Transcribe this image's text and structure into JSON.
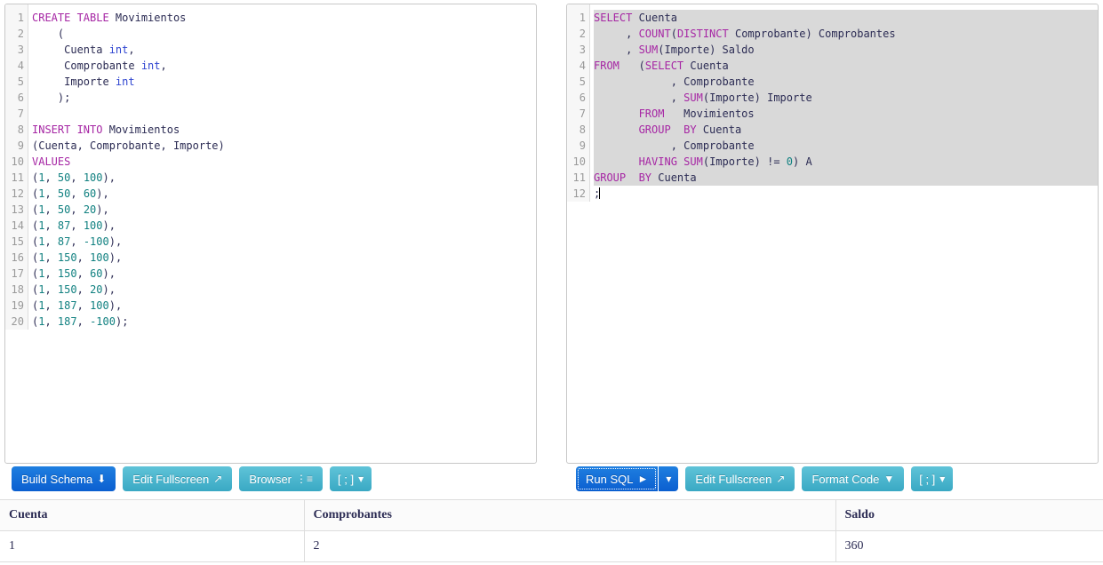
{
  "schema_editor": {
    "name": "schema-sql-editor",
    "line_count": 20,
    "lines": [
      [
        {
          "t": "CREATE TABLE ",
          "c": "kw"
        },
        {
          "t": "Movimientos",
          "c": "id"
        }
      ],
      [
        {
          "t": "    (",
          "c": "id"
        }
      ],
      [
        {
          "t": "     Cuenta ",
          "c": "id"
        },
        {
          "t": "int",
          "c": "typ"
        },
        {
          "t": ",",
          "c": "id"
        }
      ],
      [
        {
          "t": "     Comprobante ",
          "c": "id"
        },
        {
          "t": "int",
          "c": "typ"
        },
        {
          "t": ",",
          "c": "id"
        }
      ],
      [
        {
          "t": "     Importe ",
          "c": "id"
        },
        {
          "t": "int",
          "c": "typ"
        }
      ],
      [
        {
          "t": "    );",
          "c": "id"
        }
      ],
      [],
      [
        {
          "t": "INSERT INTO ",
          "c": "kw"
        },
        {
          "t": "Movimientos",
          "c": "id"
        }
      ],
      [
        {
          "t": "(Cuenta, Comprobante, Importe)",
          "c": "id"
        }
      ],
      [
        {
          "t": "VALUES",
          "c": "kw"
        }
      ],
      [
        {
          "t": "(",
          "c": "id"
        },
        {
          "t": "1",
          "c": "num"
        },
        {
          "t": ", ",
          "c": "id"
        },
        {
          "t": "50",
          "c": "num"
        },
        {
          "t": ", ",
          "c": "id"
        },
        {
          "t": "100",
          "c": "num"
        },
        {
          "t": "),",
          "c": "id"
        }
      ],
      [
        {
          "t": "(",
          "c": "id"
        },
        {
          "t": "1",
          "c": "num"
        },
        {
          "t": ", ",
          "c": "id"
        },
        {
          "t": "50",
          "c": "num"
        },
        {
          "t": ", ",
          "c": "id"
        },
        {
          "t": "60",
          "c": "num"
        },
        {
          "t": "),",
          "c": "id"
        }
      ],
      [
        {
          "t": "(",
          "c": "id"
        },
        {
          "t": "1",
          "c": "num"
        },
        {
          "t": ", ",
          "c": "id"
        },
        {
          "t": "50",
          "c": "num"
        },
        {
          "t": ", ",
          "c": "id"
        },
        {
          "t": "20",
          "c": "num"
        },
        {
          "t": "),",
          "c": "id"
        }
      ],
      [
        {
          "t": "(",
          "c": "id"
        },
        {
          "t": "1",
          "c": "num"
        },
        {
          "t": ", ",
          "c": "id"
        },
        {
          "t": "87",
          "c": "num"
        },
        {
          "t": ", ",
          "c": "id"
        },
        {
          "t": "100",
          "c": "num"
        },
        {
          "t": "),",
          "c": "id"
        }
      ],
      [
        {
          "t": "(",
          "c": "id"
        },
        {
          "t": "1",
          "c": "num"
        },
        {
          "t": ", ",
          "c": "id"
        },
        {
          "t": "87",
          "c": "num"
        },
        {
          "t": ", ",
          "c": "id"
        },
        {
          "t": "-100",
          "c": "num"
        },
        {
          "t": "),",
          "c": "id"
        }
      ],
      [
        {
          "t": "(",
          "c": "id"
        },
        {
          "t": "1",
          "c": "num"
        },
        {
          "t": ", ",
          "c": "id"
        },
        {
          "t": "150",
          "c": "num"
        },
        {
          "t": ", ",
          "c": "id"
        },
        {
          "t": "100",
          "c": "num"
        },
        {
          "t": "),",
          "c": "id"
        }
      ],
      [
        {
          "t": "(",
          "c": "id"
        },
        {
          "t": "1",
          "c": "num"
        },
        {
          "t": ", ",
          "c": "id"
        },
        {
          "t": "150",
          "c": "num"
        },
        {
          "t": ", ",
          "c": "id"
        },
        {
          "t": "60",
          "c": "num"
        },
        {
          "t": "),",
          "c": "id"
        }
      ],
      [
        {
          "t": "(",
          "c": "id"
        },
        {
          "t": "1",
          "c": "num"
        },
        {
          "t": ", ",
          "c": "id"
        },
        {
          "t": "150",
          "c": "num"
        },
        {
          "t": ", ",
          "c": "id"
        },
        {
          "t": "20",
          "c": "num"
        },
        {
          "t": "),",
          "c": "id"
        }
      ],
      [
        {
          "t": "(",
          "c": "id"
        },
        {
          "t": "1",
          "c": "num"
        },
        {
          "t": ", ",
          "c": "id"
        },
        {
          "t": "187",
          "c": "num"
        },
        {
          "t": ", ",
          "c": "id"
        },
        {
          "t": "100",
          "c": "num"
        },
        {
          "t": "),",
          "c": "id"
        }
      ],
      [
        {
          "t": "(",
          "c": "id"
        },
        {
          "t": "1",
          "c": "num"
        },
        {
          "t": ", ",
          "c": "id"
        },
        {
          "t": "187",
          "c": "num"
        },
        {
          "t": ", ",
          "c": "id"
        },
        {
          "t": "-100",
          "c": "num"
        },
        {
          "t": ");",
          "c": "id"
        }
      ]
    ]
  },
  "query_editor": {
    "name": "query-sql-editor",
    "line_count": 12,
    "selected_lines": [
      1,
      2,
      3,
      4,
      5,
      6,
      7,
      8,
      9,
      10,
      11
    ],
    "caret_line": 12,
    "lines": [
      [
        {
          "t": "SELECT ",
          "c": "kw"
        },
        {
          "t": "Cuenta",
          "c": "id"
        }
      ],
      [
        {
          "t": "     , ",
          "c": "id"
        },
        {
          "t": "COUNT",
          "c": "kw"
        },
        {
          "t": "(",
          "c": "id"
        },
        {
          "t": "DISTINCT ",
          "c": "kw"
        },
        {
          "t": "Comprobante) Comprobantes",
          "c": "id"
        }
      ],
      [
        {
          "t": "     , ",
          "c": "id"
        },
        {
          "t": "SUM",
          "c": "kw"
        },
        {
          "t": "(Importe) Saldo",
          "c": "id"
        }
      ],
      [
        {
          "t": "FROM",
          "c": "kw"
        },
        {
          "t": "   (",
          "c": "id"
        },
        {
          "t": "SELECT ",
          "c": "kw"
        },
        {
          "t": "Cuenta",
          "c": "id"
        }
      ],
      [
        {
          "t": "            , Comprobante",
          "c": "id"
        }
      ],
      [
        {
          "t": "            , ",
          "c": "id"
        },
        {
          "t": "SUM",
          "c": "kw"
        },
        {
          "t": "(Importe) Importe",
          "c": "id"
        }
      ],
      [
        {
          "t": "       ",
          "c": "id"
        },
        {
          "t": "FROM",
          "c": "kw"
        },
        {
          "t": "   Movimientos",
          "c": "id"
        }
      ],
      [
        {
          "t": "       ",
          "c": "id"
        },
        {
          "t": "GROUP  BY ",
          "c": "kw"
        },
        {
          "t": "Cuenta",
          "c": "id"
        }
      ],
      [
        {
          "t": "            , Comprobante",
          "c": "id"
        }
      ],
      [
        {
          "t": "       ",
          "c": "id"
        },
        {
          "t": "HAVING ",
          "c": "kw"
        },
        {
          "t": "SUM",
          "c": "kw"
        },
        {
          "t": "(Importe) != ",
          "c": "id"
        },
        {
          "t": "0",
          "c": "num"
        },
        {
          "t": ") A",
          "c": "id"
        }
      ],
      [
        {
          "t": "GROUP  BY ",
          "c": "kw"
        },
        {
          "t": "Cuenta",
          "c": "id"
        }
      ],
      [
        {
          "t": ";",
          "c": "id"
        }
      ]
    ]
  },
  "schema_toolbar": {
    "build_schema": "Build Schema",
    "build_schema_icon": "download-icon",
    "edit_fullscreen": "Edit Fullscreen",
    "edit_fullscreen_icon": "expand-arrows-icon",
    "browser": "Browser",
    "browser_icon": "tree-indent-icon",
    "terminator": "[ ; ]",
    "terminator_caret": "▾"
  },
  "query_toolbar": {
    "run_sql": "Run SQL",
    "run_sql_icon": "play-icon",
    "run_sql_caret": "▾",
    "edit_fullscreen": "Edit Fullscreen",
    "edit_fullscreen_icon": "expand-arrows-icon",
    "format_code": "Format Code",
    "format_code_icon": "filter-caret-icon",
    "terminator": "[ ; ]",
    "terminator_caret": "▾"
  },
  "results": {
    "columns": [
      "Cuenta",
      "Comprobantes",
      "Saldo"
    ],
    "rows": [
      [
        "1",
        "2",
        "360"
      ]
    ]
  },
  "colors": {
    "primary_button": "#0b5fd0",
    "secondary_button": "#3aa9c4",
    "keyword": "#a626a4",
    "datatype": "#2f45d0",
    "number": "#108080",
    "identifier": "#2c2c54",
    "selection": "#d9d9d9"
  }
}
